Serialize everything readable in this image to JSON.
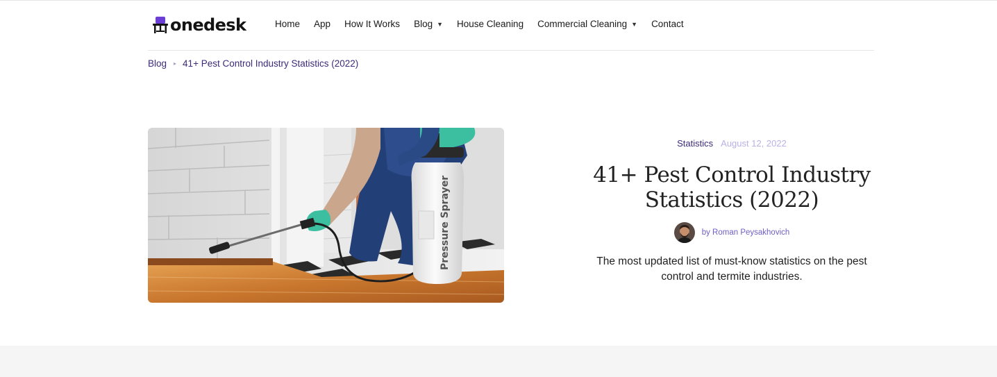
{
  "brand": {
    "name": "onedesk",
    "logo_icon": "chair-icon",
    "accent": "#3b2a79",
    "icon_color": "#6b3fd6"
  },
  "nav": {
    "items": [
      {
        "label": "Home",
        "dropdown": false
      },
      {
        "label": "App",
        "dropdown": false
      },
      {
        "label": "How It Works",
        "dropdown": false
      },
      {
        "label": "Blog",
        "dropdown": true
      },
      {
        "label": "House Cleaning",
        "dropdown": false
      },
      {
        "label": "Commercial Cleaning",
        "dropdown": true
      },
      {
        "label": "Contact",
        "dropdown": false
      }
    ],
    "caret": "▼"
  },
  "breadcrumb": {
    "items": [
      "Blog",
      "41+ Pest Control Industry Statistics (2022)"
    ],
    "separator": "▸"
  },
  "article": {
    "category": "Statistics",
    "date": "August 12, 2022",
    "title": "41+ Pest Control Industry Statistics (2022)",
    "author": "by Roman Peysakhovich",
    "excerpt": "The most updated list of must-know statistics on the pest control and termite industries.",
    "image_label": "Pressure Sprayer",
    "date_color": "#b9b0e6",
    "author_color": "#6f5fc4"
  }
}
